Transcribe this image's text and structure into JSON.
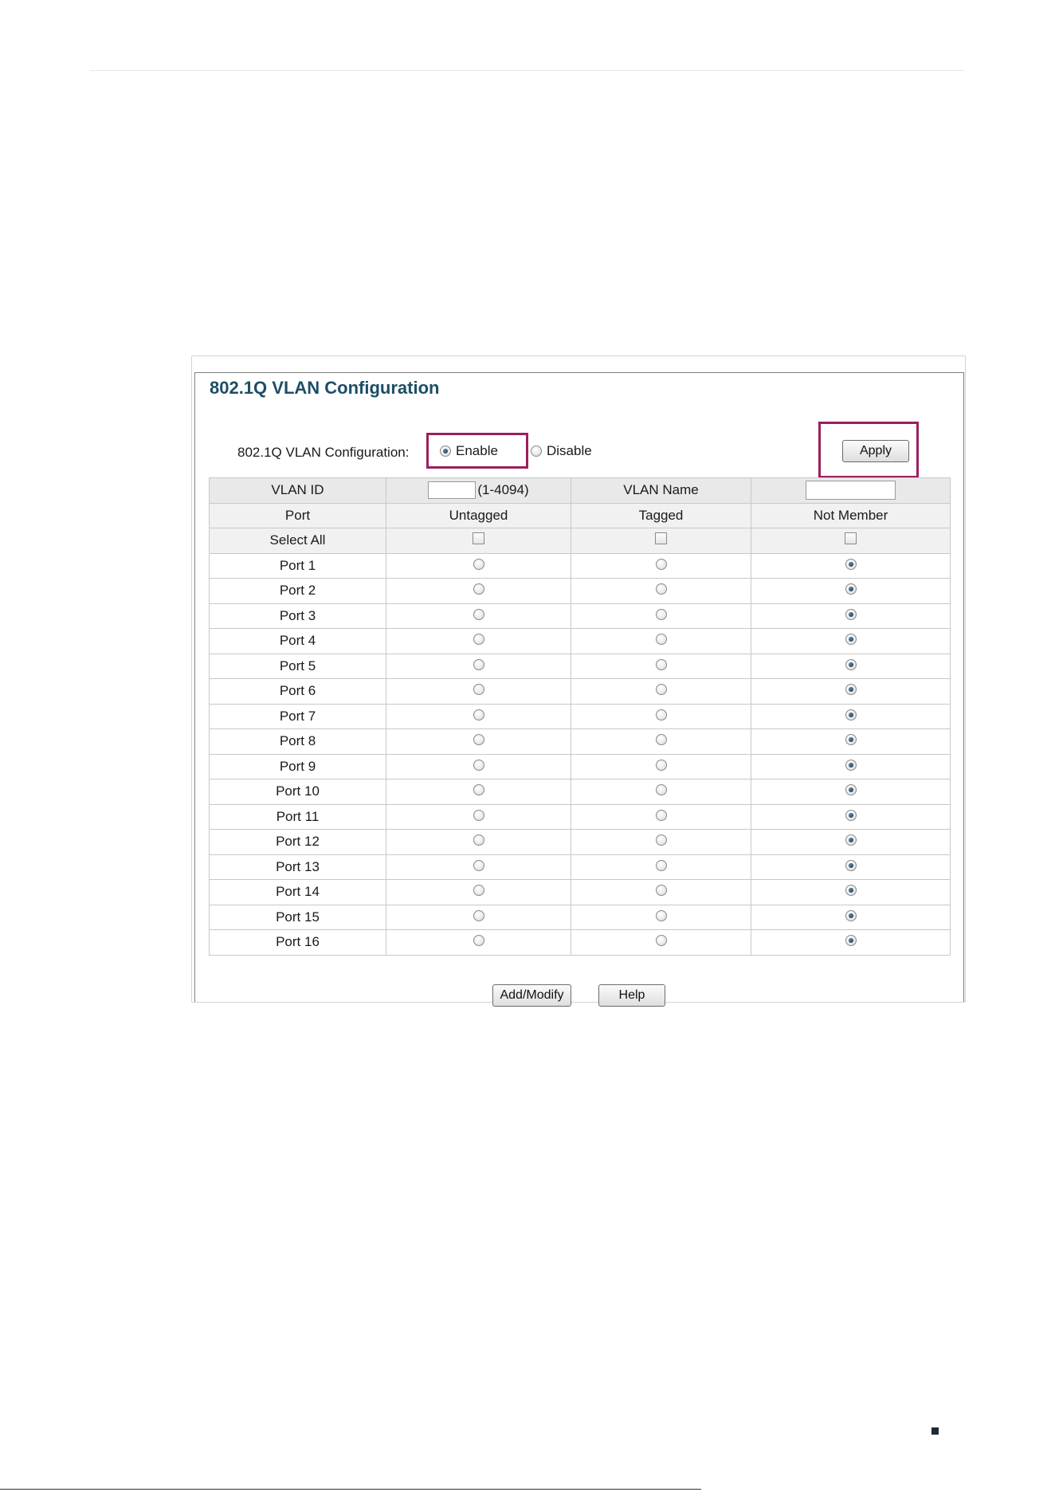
{
  "section_title": "802.1Q VLAN Configuration",
  "config": {
    "label": "802.1Q VLAN Configuration:",
    "enable_label": "Enable",
    "disable_label": "Disable",
    "selected": "enable",
    "apply_label": "Apply"
  },
  "table": {
    "vlan_id_label": "VLAN ID",
    "vlan_id_value": "",
    "vlan_id_range": "(1-4094)",
    "vlan_name_label": "VLAN Name",
    "vlan_name_value": "",
    "columns": [
      "Port",
      "Untagged",
      "Tagged",
      "Not Member"
    ],
    "select_all_label": "Select All",
    "ports": [
      {
        "name": "Port 1",
        "membership": "not_member"
      },
      {
        "name": "Port 2",
        "membership": "not_member"
      },
      {
        "name": "Port 3",
        "membership": "not_member"
      },
      {
        "name": "Port 4",
        "membership": "not_member"
      },
      {
        "name": "Port 5",
        "membership": "not_member"
      },
      {
        "name": "Port 6",
        "membership": "not_member"
      },
      {
        "name": "Port 7",
        "membership": "not_member"
      },
      {
        "name": "Port 8",
        "membership": "not_member"
      },
      {
        "name": "Port 9",
        "membership": "not_member"
      },
      {
        "name": "Port 10",
        "membership": "not_member"
      },
      {
        "name": "Port 11",
        "membership": "not_member"
      },
      {
        "name": "Port 12",
        "membership": "not_member"
      },
      {
        "name": "Port 13",
        "membership": "not_member"
      },
      {
        "name": "Port 14",
        "membership": "not_member"
      },
      {
        "name": "Port 15",
        "membership": "not_member"
      },
      {
        "name": "Port 16",
        "membership": "not_member"
      }
    ]
  },
  "buttons": {
    "add_modify": "Add/Modify",
    "help": "Help"
  },
  "colors": {
    "title": "#1c4e66",
    "highlight": "#9c1f5e"
  }
}
